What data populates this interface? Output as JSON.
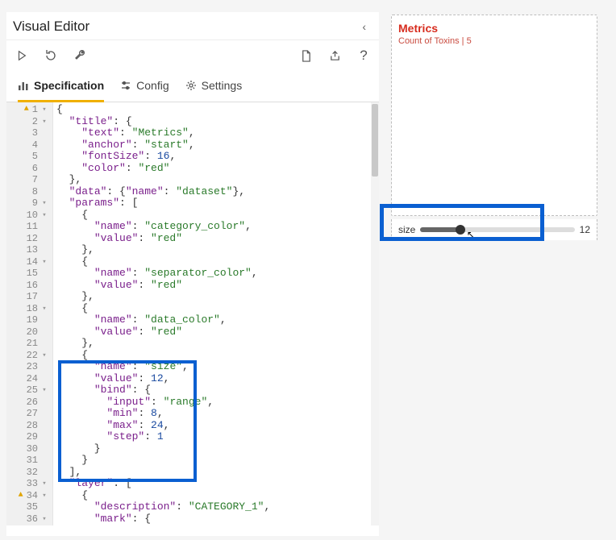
{
  "editor": {
    "title": "Visual Editor",
    "toolbar": {
      "play": "play",
      "reset": "reset",
      "wrench": "wrench",
      "newdoc": "new",
      "share": "share",
      "help": "?"
    },
    "tabs": {
      "spec": "Specification",
      "config": "Config",
      "settings": "Settings"
    }
  },
  "code_lines": [
    {
      "n": 1,
      "warn": true,
      "fold": "▾",
      "t": [
        [
          "p",
          "{"
        ]
      ]
    },
    {
      "n": 2,
      "fold": "▾",
      "t": [
        [
          "p",
          "  "
        ],
        [
          "k",
          "\"title\""
        ],
        [
          "p",
          ": {"
        ]
      ]
    },
    {
      "n": 3,
      "t": [
        [
          "p",
          "    "
        ],
        [
          "k",
          "\"text\""
        ],
        [
          "p",
          ": "
        ],
        [
          "s",
          "\"Metrics\""
        ],
        [
          "p",
          ","
        ]
      ]
    },
    {
      "n": 4,
      "t": [
        [
          "p",
          "    "
        ],
        [
          "k",
          "\"anchor\""
        ],
        [
          "p",
          ": "
        ],
        [
          "s",
          "\"start\""
        ],
        [
          "p",
          ","
        ]
      ]
    },
    {
      "n": 5,
      "t": [
        [
          "p",
          "    "
        ],
        [
          "k",
          "\"fontSize\""
        ],
        [
          "p",
          ": "
        ],
        [
          "n",
          "16"
        ],
        [
          "p",
          ","
        ]
      ]
    },
    {
      "n": 6,
      "t": [
        [
          "p",
          "    "
        ],
        [
          "k",
          "\"color\""
        ],
        [
          "p",
          ": "
        ],
        [
          "s",
          "\"red\""
        ]
      ]
    },
    {
      "n": 7,
      "t": [
        [
          "p",
          "  },"
        ]
      ]
    },
    {
      "n": 8,
      "t": [
        [
          "p",
          "  "
        ],
        [
          "k",
          "\"data\""
        ],
        [
          "p",
          ": {"
        ],
        [
          "k",
          "\"name\""
        ],
        [
          "p",
          ": "
        ],
        [
          "s",
          "\"dataset\""
        ],
        [
          "p",
          "},"
        ]
      ]
    },
    {
      "n": 9,
      "fold": "▾",
      "t": [
        [
          "p",
          "  "
        ],
        [
          "k",
          "\"params\""
        ],
        [
          "p",
          ": ["
        ]
      ]
    },
    {
      "n": 10,
      "fold": "▾",
      "t": [
        [
          "p",
          "    {"
        ]
      ]
    },
    {
      "n": 11,
      "t": [
        [
          "p",
          "      "
        ],
        [
          "k",
          "\"name\""
        ],
        [
          "p",
          ": "
        ],
        [
          "s",
          "\"category_color\""
        ],
        [
          "p",
          ","
        ]
      ]
    },
    {
      "n": 12,
      "t": [
        [
          "p",
          "      "
        ],
        [
          "k",
          "\"value\""
        ],
        [
          "p",
          ": "
        ],
        [
          "s",
          "\"red\""
        ]
      ]
    },
    {
      "n": 13,
      "t": [
        [
          "p",
          "    },"
        ]
      ]
    },
    {
      "n": 14,
      "fold": "▾",
      "t": [
        [
          "p",
          "    {"
        ]
      ]
    },
    {
      "n": 15,
      "t": [
        [
          "p",
          "      "
        ],
        [
          "k",
          "\"name\""
        ],
        [
          "p",
          ": "
        ],
        [
          "s",
          "\"separator_color\""
        ],
        [
          "p",
          ","
        ]
      ]
    },
    {
      "n": 16,
      "t": [
        [
          "p",
          "      "
        ],
        [
          "k",
          "\"value\""
        ],
        [
          "p",
          ": "
        ],
        [
          "s",
          "\"red\""
        ]
      ]
    },
    {
      "n": 17,
      "t": [
        [
          "p",
          "    },"
        ]
      ]
    },
    {
      "n": 18,
      "fold": "▾",
      "t": [
        [
          "p",
          "    {"
        ]
      ]
    },
    {
      "n": 19,
      "t": [
        [
          "p",
          "      "
        ],
        [
          "k",
          "\"name\""
        ],
        [
          "p",
          ": "
        ],
        [
          "s",
          "\"data_color\""
        ],
        [
          "p",
          ","
        ]
      ]
    },
    {
      "n": 20,
      "t": [
        [
          "p",
          "      "
        ],
        [
          "k",
          "\"value\""
        ],
        [
          "p",
          ": "
        ],
        [
          "s",
          "\"red\""
        ]
      ]
    },
    {
      "n": 21,
      "t": [
        [
          "p",
          "    },"
        ]
      ]
    },
    {
      "n": 22,
      "fold": "▾",
      "t": [
        [
          "p",
          "    {"
        ]
      ]
    },
    {
      "n": 23,
      "t": [
        [
          "p",
          "      "
        ],
        [
          "k",
          "\"name\""
        ],
        [
          "p",
          ": "
        ],
        [
          "s",
          "\"size\""
        ],
        [
          "p",
          ","
        ]
      ]
    },
    {
      "n": 24,
      "t": [
        [
          "p",
          "      "
        ],
        [
          "k",
          "\"value\""
        ],
        [
          "p",
          ": "
        ],
        [
          "n",
          "12"
        ],
        [
          "p",
          ","
        ]
      ]
    },
    {
      "n": 25,
      "fold": "▾",
      "t": [
        [
          "p",
          "      "
        ],
        [
          "k",
          "\"bind\""
        ],
        [
          "p",
          ": {"
        ]
      ]
    },
    {
      "n": 26,
      "t": [
        [
          "p",
          "        "
        ],
        [
          "k",
          "\"input\""
        ],
        [
          "p",
          ": "
        ],
        [
          "s",
          "\"range\""
        ],
        [
          "p",
          ","
        ]
      ]
    },
    {
      "n": 27,
      "t": [
        [
          "p",
          "        "
        ],
        [
          "k",
          "\"min\""
        ],
        [
          "p",
          ": "
        ],
        [
          "n",
          "8"
        ],
        [
          "p",
          ","
        ]
      ]
    },
    {
      "n": 28,
      "t": [
        [
          "p",
          "        "
        ],
        [
          "k",
          "\"max\""
        ],
        [
          "p",
          ": "
        ],
        [
          "n",
          "24"
        ],
        [
          "p",
          ","
        ]
      ]
    },
    {
      "n": 29,
      "t": [
        [
          "p",
          "        "
        ],
        [
          "k",
          "\"step\""
        ],
        [
          "p",
          ": "
        ],
        [
          "n",
          "1"
        ]
      ]
    },
    {
      "n": 30,
      "t": [
        [
          "p",
          "      }"
        ]
      ]
    },
    {
      "n": 31,
      "t": [
        [
          "p",
          "    }"
        ]
      ]
    },
    {
      "n": 32,
      "t": [
        [
          "p",
          "  ],"
        ]
      ]
    },
    {
      "n": 33,
      "fold": "▾",
      "t": [
        [
          "p",
          "  "
        ],
        [
          "k",
          "\"layer\""
        ],
        [
          "p",
          ": ["
        ]
      ]
    },
    {
      "n": 34,
      "warn": true,
      "fold": "▾",
      "t": [
        [
          "p",
          "    {"
        ]
      ]
    },
    {
      "n": 35,
      "t": [
        [
          "p",
          "      "
        ],
        [
          "k",
          "\"description\""
        ],
        [
          "p",
          ": "
        ],
        [
          "s",
          "\"CATEGORY_1\""
        ],
        [
          "p",
          ","
        ]
      ]
    },
    {
      "n": 36,
      "fold": "▾",
      "t": [
        [
          "p",
          "      "
        ],
        [
          "k",
          "\"mark\""
        ],
        [
          "p",
          ": {"
        ]
      ]
    }
  ],
  "preview": {
    "title": "Metrics",
    "subtitle": "Count of Toxins | 5",
    "slider_label": "size",
    "slider_value": "12"
  }
}
